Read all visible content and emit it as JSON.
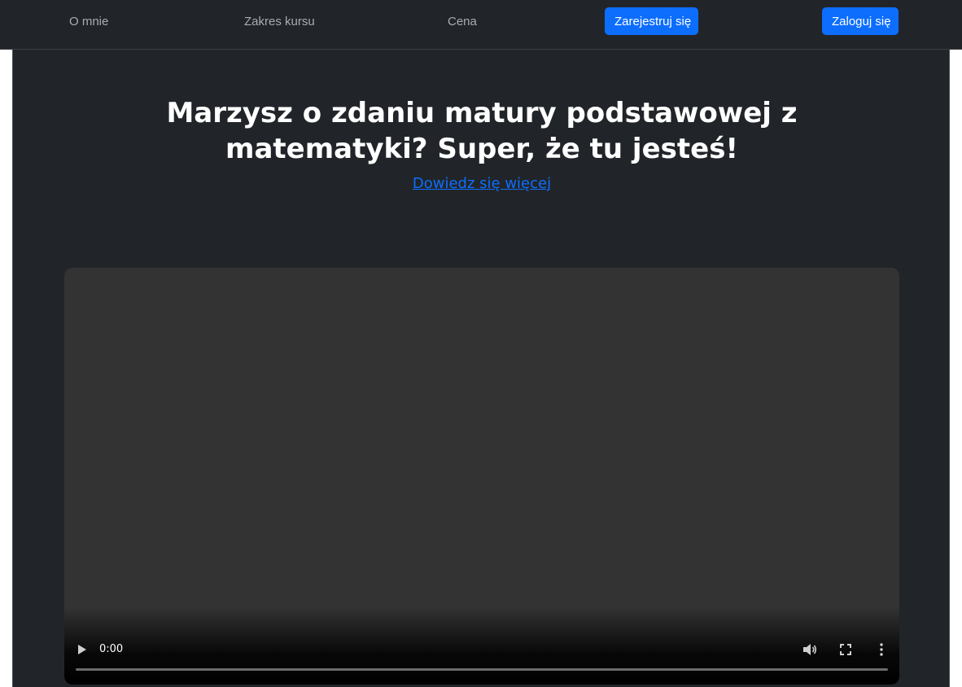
{
  "nav": {
    "links": [
      "O mnie",
      "Zakres kursu",
      "Cena"
    ],
    "register_label": "Zarejestruj się",
    "login_label": "Zaloguj się"
  },
  "hero": {
    "title_line1": "Marzysz o zdaniu matury podstawowej z",
    "title_line2": "matematyki? Super, że tu jesteś!",
    "learn_more": "Dowiedz się więcej"
  },
  "video": {
    "time": "0:00",
    "progress": 0,
    "icons": [
      "play-icon",
      "volume-icon",
      "fullscreen-icon",
      "more-options-icon"
    ]
  },
  "colors": {
    "accent": "#0d6efd",
    "background": "#212529",
    "video_bg": "#333333"
  }
}
